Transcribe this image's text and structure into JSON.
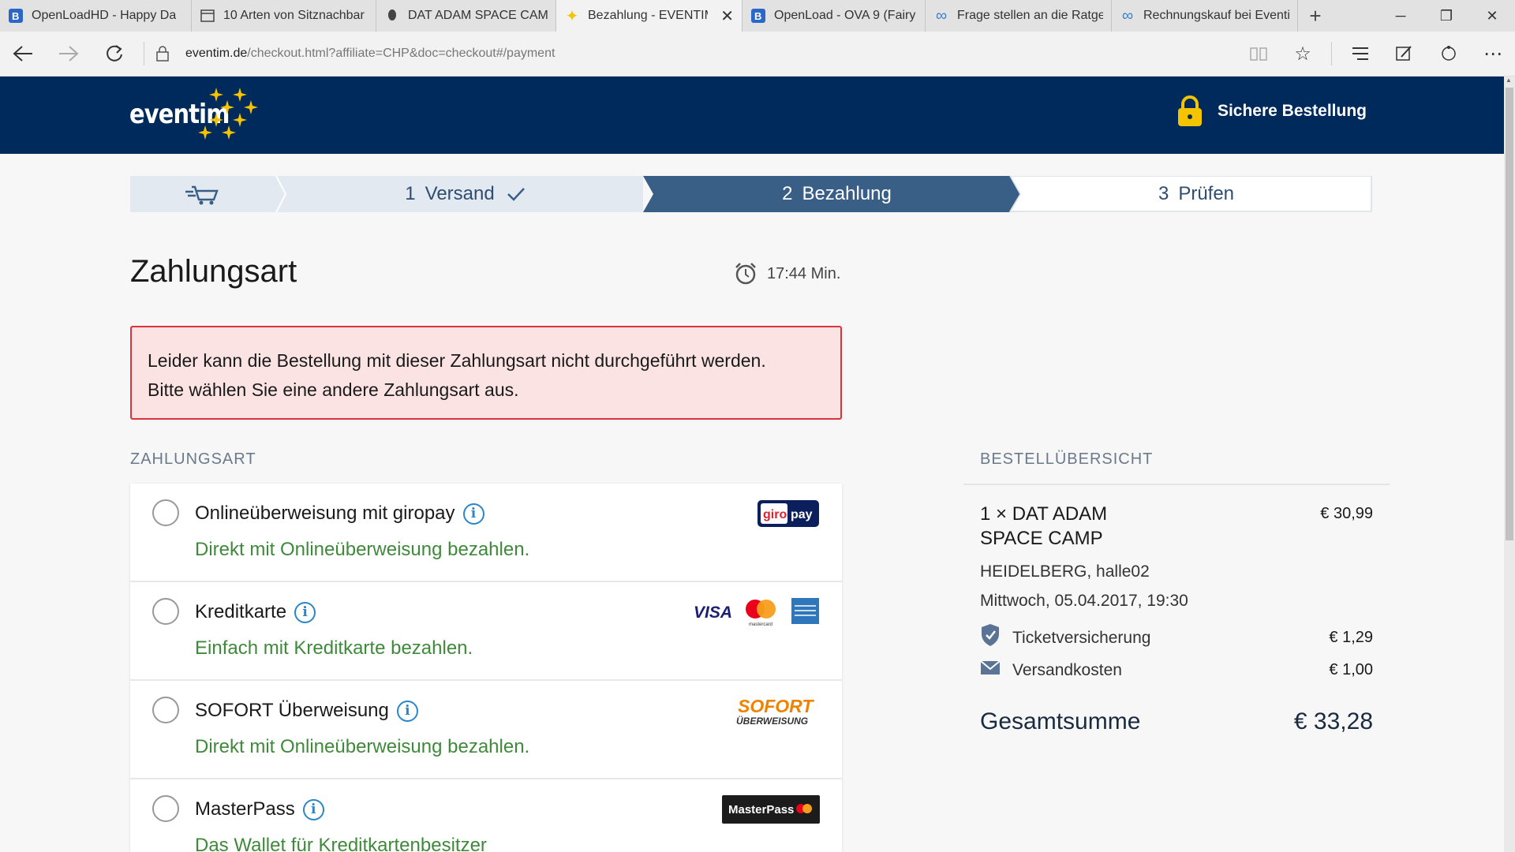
{
  "browser": {
    "tabs": [
      {
        "title": "OpenLoadHD - Happy Da",
        "icon": "blogger-icon",
        "active": false
      },
      {
        "title": "10 Arten von Sitznachbar",
        "icon": "page-icon",
        "active": false
      },
      {
        "title": "DAT ADAM SPACE CAMP",
        "icon": "leaf-icon",
        "active": false
      },
      {
        "title": "Bezahlung - EVENTIM",
        "icon": "star-icon",
        "active": true
      },
      {
        "title": "OpenLoad - OVA 9 (Fairy",
        "icon": "blogger-icon",
        "active": false
      },
      {
        "title": "Frage stellen an die Ratge",
        "icon": "infinity-icon",
        "active": false
      },
      {
        "title": "Rechnungskauf bei Eventi",
        "icon": "infinity-icon",
        "active": false
      }
    ],
    "url_domain": "eventim.de",
    "url_rest": "/checkout.html?affiliate=CHP&doc=checkout#/payment"
  },
  "header": {
    "logo_text": "eventim",
    "secure_label": "Sichere Bestellung"
  },
  "steps": {
    "step1": {
      "num": "1",
      "label": "Versand",
      "done": true
    },
    "step2": {
      "num": "2",
      "label": "Bezahlung",
      "active": true
    },
    "step3": {
      "num": "3",
      "label": "Prüfen"
    }
  },
  "main": {
    "title": "Zahlungsart",
    "timer": "17:44 Min.",
    "error_line1": "Leider kann die Bestellung mit dieser Zahlungsart nicht durchgeführt werden.",
    "error_line2": "Bitte wählen Sie eine andere Zahlungsart aus.",
    "section_label": "ZAHLUNGSART",
    "payments": [
      {
        "name": "Onlineüberweisung mit giropay",
        "desc": "Direkt mit Onlineüberweisung bezahlen.",
        "logo": "giropay"
      },
      {
        "name": "Kreditkarte",
        "desc": "Einfach mit Kreditkarte bezahlen.",
        "logo": "creditcards"
      },
      {
        "name": "SOFORT Überweisung",
        "desc": "Direkt mit Onlineüberweisung bezahlen.",
        "logo": "sofort"
      },
      {
        "name": "MasterPass",
        "desc": "Das Wallet für Kreditkartenbesitzer",
        "logo": "masterpass"
      }
    ],
    "logos": {
      "giro": "giro",
      "pay": "pay",
      "visa": "VISA",
      "mastercard": "mastercard",
      "sofort_top": "SOFORT",
      "sofort_bottom": "ÜBERWEISUNG",
      "masterpass": "MasterPass"
    }
  },
  "summary": {
    "label": "BESTELLÜBERSICHT",
    "item_line1": "1 × DAT ADAM",
    "item_line2": "SPACE CAMP",
    "item_price": "€ 30,99",
    "venue": "HEIDELBERG, halle02",
    "date": "Mittwoch, 05.04.2017, 19:30",
    "insurance_label": "Ticketversicherung",
    "insurance_price": "€ 1,29",
    "shipping_label": "Versandkosten",
    "shipping_price": "€ 1,00",
    "total_label": "Gesamtsumme",
    "total_value": "€ 33,28"
  },
  "colors": {
    "brand_navy": "#002a5c",
    "step_active": "#3a5f86",
    "step_done": "#e3e9f0",
    "error_border": "#d9333b",
    "success_text": "#3f8a3a",
    "info_blue": "#2a86c8",
    "lock_gold": "#f5c400"
  }
}
